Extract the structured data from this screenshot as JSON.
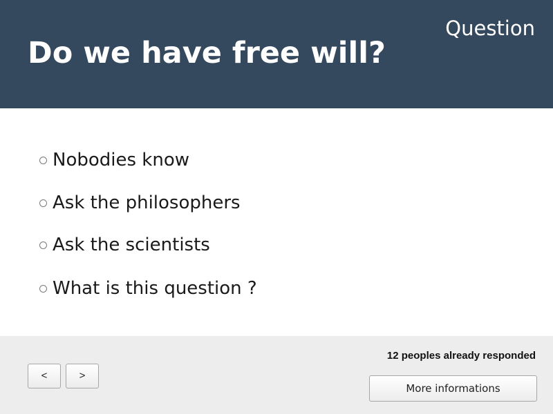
{
  "header": {
    "label": "Question",
    "title": "Do we have free will?",
    "background_color": "#34495e"
  },
  "options": [
    {
      "label": "Nobodies know",
      "icon": "radio-unchecked-icon"
    },
    {
      "label": "Ask the philosophers",
      "icon": "radio-unchecked-icon"
    },
    {
      "label": "Ask the scientists",
      "icon": "radio-unchecked-icon"
    },
    {
      "label": "What is this question ?",
      "icon": "radio-unchecked-icon"
    }
  ],
  "footer": {
    "background_color": "#ededed",
    "prev_label": "<",
    "next_label": ">",
    "response_count": "12 peoples already responded",
    "more_label": "More informations"
  }
}
